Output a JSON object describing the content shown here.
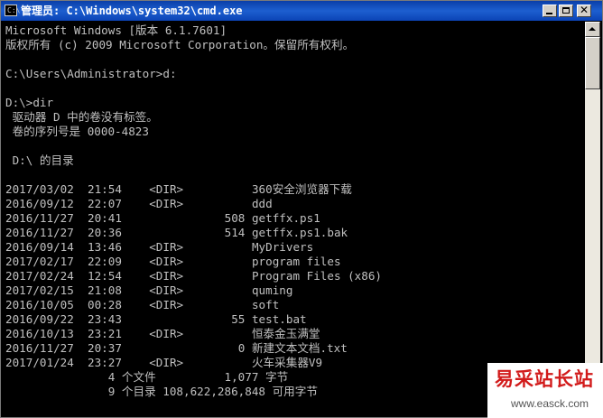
{
  "window": {
    "title": "管理员: C:\\Windows\\system32\\cmd.exe",
    "icon_label": "C:\\"
  },
  "console": {
    "lines": [
      "Microsoft Windows [版本 6.1.7601]",
      "版权所有 (c) 2009 Microsoft Corporation。保留所有权利。",
      "",
      "C:\\Users\\Administrator>d:",
      "",
      "D:\\>dir",
      " 驱动器 D 中的卷没有标签。",
      " 卷的序列号是 0000-4823",
      "",
      " D:\\ 的目录",
      "",
      "2017/03/02  21:54    <DIR>          360安全浏览器下载",
      "2016/09/12  22:07    <DIR>          ddd",
      "2016/11/27  20:41               508 getffx.ps1",
      "2016/11/27  20:36               514 getffx.ps1.bak",
      "2016/09/14  13:46    <DIR>          MyDrivers",
      "2017/02/17  22:09    <DIR>          program files",
      "2017/02/24  12:54    <DIR>          Program Files (x86)",
      "2017/02/15  21:08    <DIR>          quming",
      "2016/10/05  00:28    <DIR>          soft",
      "2016/09/22  23:43                55 test.bat",
      "2016/10/13  23:21    <DIR>          恒泰金玉满堂",
      "2016/11/27  20:37                 0 新建文本文档.txt",
      "2017/01/24  23:27    <DIR>          火车采集器V9",
      "               4 个文件          1,077 字节",
      "               9 个目录 108,622,286,848 可用字节"
    ]
  },
  "watermark": {
    "title": "易采站长站",
    "url": "www.easck.com"
  },
  "colors": {
    "console_bg": "#000000",
    "console_text": "#c0c0c0",
    "titlebar": "#0a3fa8",
    "watermark_text": "#d21b1b"
  },
  "icons": {
    "app": "cmd-icon",
    "minimize": "minimize-icon",
    "maximize": "maximize-icon",
    "close": "close-icon",
    "scroll_up": "arrow-up-icon",
    "scroll_down": "arrow-down-icon"
  }
}
